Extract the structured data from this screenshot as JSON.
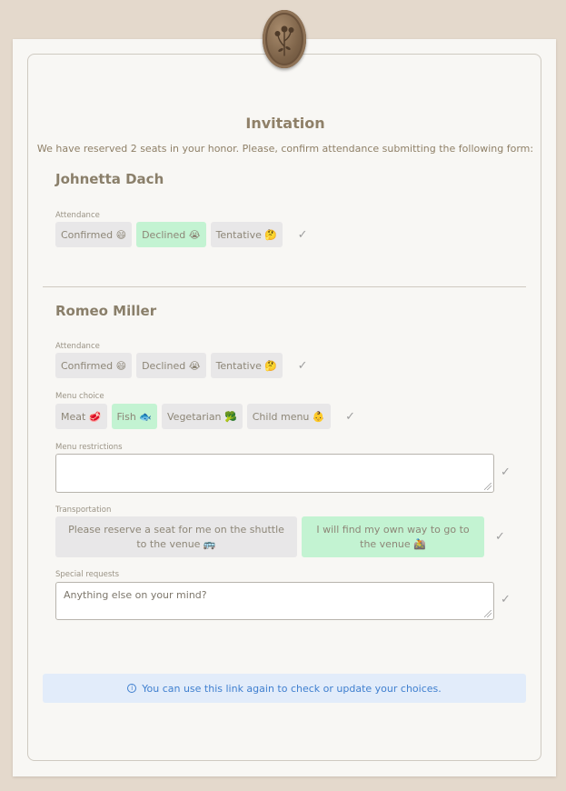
{
  "invitation": {
    "title": "Invitation",
    "subtitle": "We have reserved 2 seats in your honor. Please, confirm attendance submitting the following form:"
  },
  "guests": [
    {
      "name": "Johnetta Dach",
      "attendance_label": "Attendance",
      "attendance_options": [
        "Confirmed 😄",
        "Declined 😭",
        "Tentative 🤔"
      ],
      "attendance_selected": "Declined 😭",
      "check": "✓"
    },
    {
      "name": "Romeo Miller",
      "attendance_label": "Attendance",
      "attendance_options": [
        "Confirmed 😄",
        "Declined 😭",
        "Tentative 🤔"
      ],
      "attendance_selected": "",
      "menu_label": "Menu choice",
      "menu_options": [
        "Meat 🥩",
        "Fish 🐟",
        "Vegetarian 🥦",
        "Child menu 👶"
      ],
      "menu_selected": "Fish 🐟",
      "restrictions_label": "Menu restrictions",
      "restrictions_value": "",
      "transport_label": "Transportation",
      "transport_options": [
        "Please reserve a seat for me on the shuttle to the venue 🚌",
        "I will find my own way to go to the venue 🚵"
      ],
      "transport_selected": "I will find my own way to go to the venue 🚵",
      "requests_label": "Special requests",
      "requests_placeholder": "Anything else on your mind?",
      "check": "✓"
    }
  ],
  "info_banner": {
    "icon": "info-icon",
    "text": "You can use this link again to check or update your choices."
  },
  "colors": {
    "background": "#e4d9cc",
    "selected": "#c3f3d2",
    "unselected": "#e8e7e8",
    "info_bg": "#e2ecfa",
    "info_text": "#3f7fcf"
  }
}
